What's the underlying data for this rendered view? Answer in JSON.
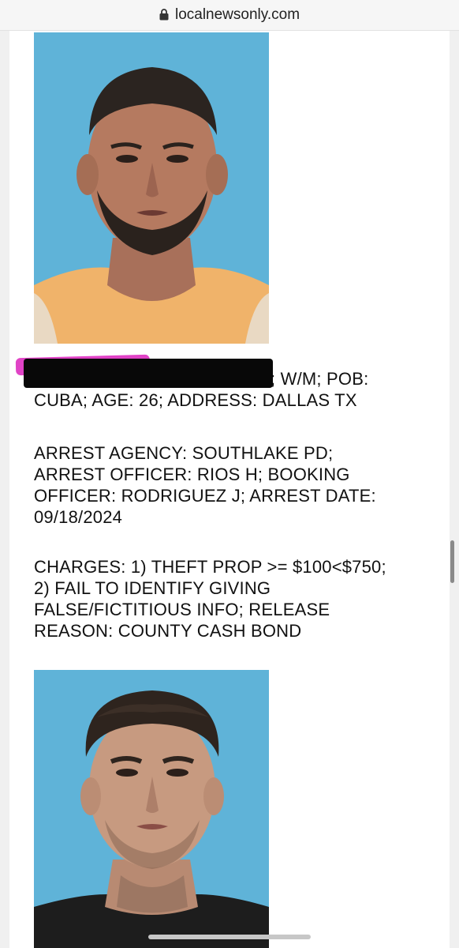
{
  "browser": {
    "url": "localnewsonly.com"
  },
  "record1": {
    "line1_suffix": "; W/M; POB:",
    "line2": "CUBA; AGE: 26; ADDRESS: DALLAS TX",
    "arrest_block": "ARREST AGENCY: SOUTHLAKE PD;\nARREST OFFICER: RIOS H; BOOKING\nOFFICER: RODRIGUEZ J; ARREST DATE:\n09/18/2024",
    "charges_block": "CHARGES: 1) THEFT PROP >= $100<$750;\n2) FAIL TO IDENTIFY GIVING\nFALSE/FICTITIOUS INFO; RELEASE\nREASON: COUNTY CASH BOND"
  },
  "colors": {
    "photo_background": "#5fb3d8",
    "redaction": "#080808",
    "highlight": "#e043c6"
  }
}
